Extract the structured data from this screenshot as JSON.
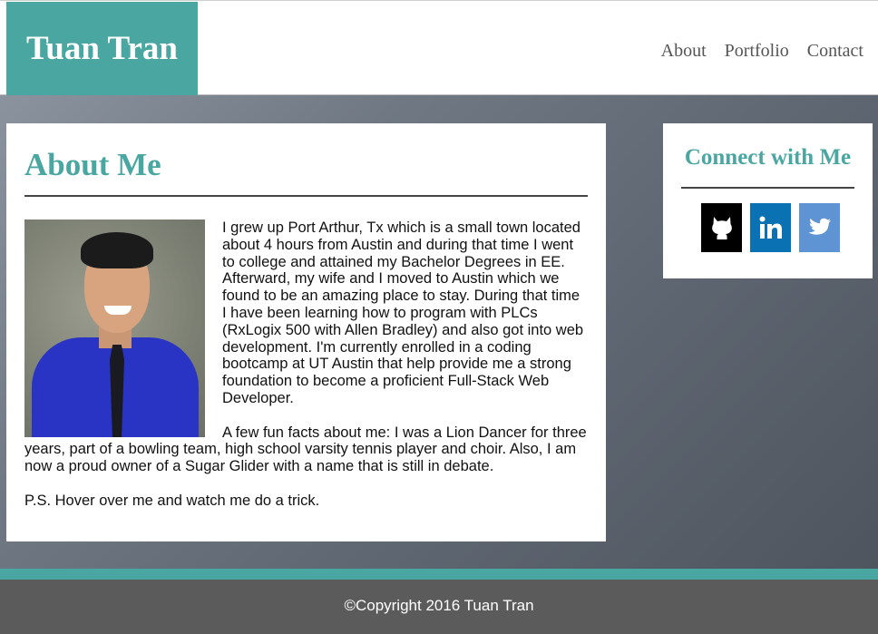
{
  "header": {
    "brand": "Tuan Tran",
    "nav": [
      "About",
      "Portfolio",
      "Contact"
    ]
  },
  "about": {
    "title": "About Me",
    "photo_alt": "Photo of Tuan Tran",
    "paragraphs": [
      "I grew up Port Arthur, Tx which is a small town located about 4 hours from Austin and during that time I went to college and attained my Bachelor Degrees in EE. Afterward, my wife and I moved to Austin which we found to be an amazing place to stay. During that time I have been learning how to program with PLCs (RxLogix 500 with Allen Bradley) and also got into web development. I'm currently enrolled in a coding bootcamp at UT Austin that help provide me a strong foundation to become a proficient Full-Stack Web Developer.",
      "A few fun facts about me: I was a Lion Dancer for three years, part of a bowling team, high school varsity tennis player and choir. Also, I am now a proud owner of a Sugar Glider with a name that is still in debate.",
      "P.S. Hover over me and watch me do a trick."
    ]
  },
  "connect": {
    "title": "Connect with Me",
    "links": [
      {
        "name": "github",
        "icon": "github-icon",
        "color": "#000000"
      },
      {
        "name": "linkedin",
        "icon": "linkedin-icon",
        "color": "#0a72b2"
      },
      {
        "name": "twitter",
        "icon": "twitter-icon",
        "color": "#5f94d4"
      }
    ]
  },
  "footer": {
    "copyright": "©Copyright 2016 Tuan Tran"
  },
  "colors": {
    "accent": "#4aa6a1",
    "footer_bg": "#5b5b5b"
  }
}
